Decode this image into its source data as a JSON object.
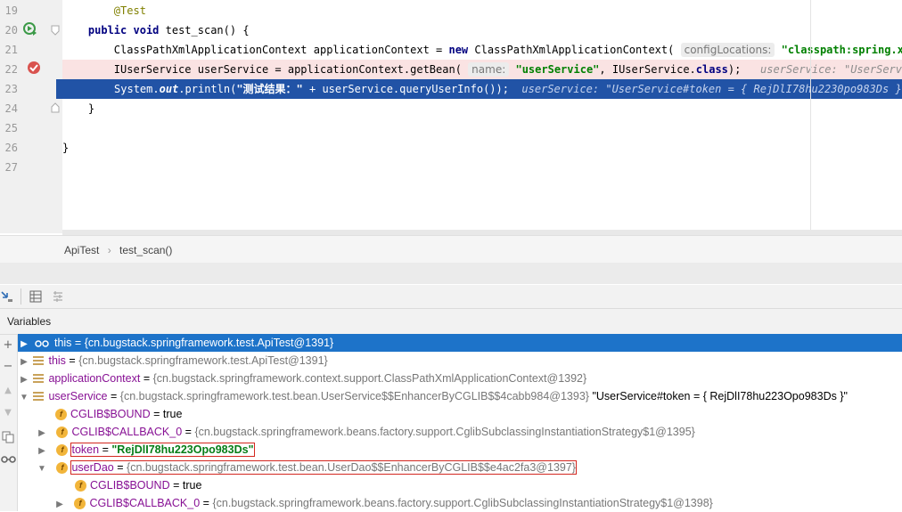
{
  "editor": {
    "line_numbers": [
      "19",
      "20",
      "21",
      "22",
      "23",
      "24",
      "25",
      "26",
      "27"
    ],
    "lines": {
      "l19_annotation": "@Test",
      "l20_kw1": "public",
      "l20_kw2": "void",
      "l20_rest": " test_scan() {",
      "l21_a": "ClassPathXmlApplicationContext applicationContext = ",
      "l21_kw": "new",
      "l21_b": " ClassPathXmlApplicationContext(",
      "l21_hint": "configLocations:",
      "l21_str": "\"classpath:spring.xml\"",
      "l21_end": ");",
      "l22_a": "IUserService userService = applicationContext.getBean(",
      "l22_hint": "name:",
      "l22_str": "\"userService\"",
      "l22_b": ", IUserService.",
      "l22_kw": "class",
      "l22_end": ");",
      "l22_inline": "userService: \"UserService#to",
      "l23_a": "System.",
      "l23_field": "out",
      "l23_b": ".println(",
      "l23_str": "\"测试结果：\"",
      "l23_c": " + userService.queryUserInfo());",
      "l23_inline": "userService: \"UserService#token = { RejDlI78hu2230po983Ds }\"",
      "l24": "}",
      "l26": "}"
    }
  },
  "breadcrumb": {
    "class_name": "ApiTest",
    "separator": "›",
    "method_name": "test_scan()"
  },
  "debug": {
    "variables_label": "Variables",
    "rows": [
      {
        "name": "this",
        "value": "{cn.bugstack.springframework.test.ApiTest@1391}"
      },
      {
        "name": "this",
        "value": "{cn.bugstack.springframework.test.ApiTest@1391}"
      },
      {
        "name": "applicationContext",
        "value": "{cn.bugstack.springframework.context.support.ClassPathXmlApplicationContext@1392}"
      },
      {
        "name": "userService",
        "value": "{cn.bugstack.springframework.test.bean.UserService$$EnhancerByCGLIB$$4cabb984@1393}",
        "extra": "\"UserService#token = { RejDlI78hu223Opo983Ds }\""
      },
      {
        "name": "CGLIB$BOUND",
        "value": "true"
      },
      {
        "name": "CGLIB$CALLBACK_0",
        "value": "{cn.bugstack.springframework.beans.factory.support.CglibSubclassingInstantiationStrategy$1@1395}"
      },
      {
        "name": "token",
        "value": "\"RejDlI78hu223Opo983Ds\""
      },
      {
        "name": "userDao",
        "value": "{cn.bugstack.springframework.test.bean.UserDao$$EnhancerByCGLIB$$e4ac2fa3@1397}"
      },
      {
        "name": "CGLIB$BOUND",
        "value": "true"
      },
      {
        "name": "CGLIB$CALLBACK_0",
        "value": "{cn.bugstack.springframework.beans.factory.support.CglibSubclassingInstantiationStrategy$1@1398}"
      }
    ],
    "eq": "="
  },
  "colors": {
    "selection": "#2153a6",
    "breakpoint_line": "#fae3e3",
    "tree_selection": "#1d73c9",
    "highlight_box": "#d3271f"
  },
  "icons": [
    "run-test-icon",
    "breakpoint-icon",
    "fold-icon",
    "plus-icon",
    "minus-icon",
    "up-arrow-icon",
    "down-arrow-icon",
    "copy-icon",
    "glasses-icon",
    "table-icon",
    "settings-icon",
    "field-icon",
    "watch-icon",
    "step-into-icon"
  ]
}
